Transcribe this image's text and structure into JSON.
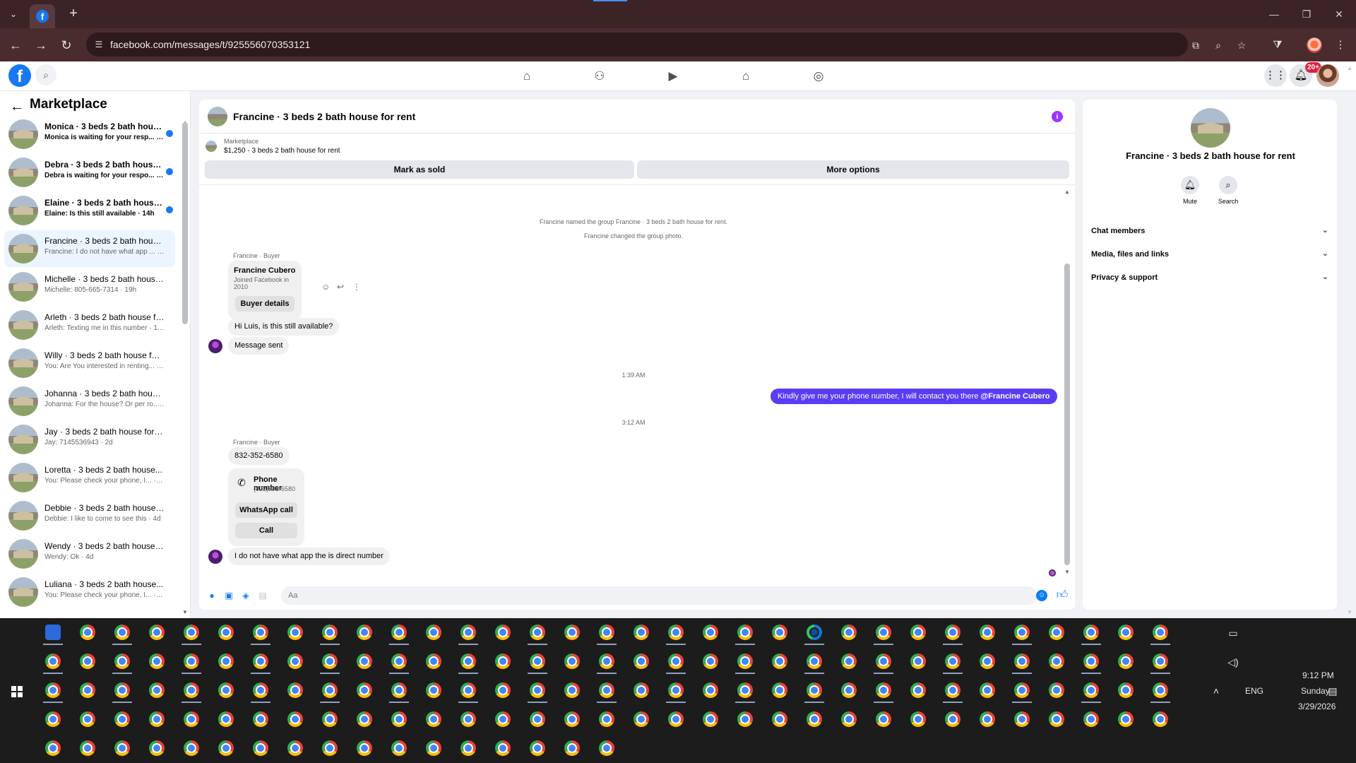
{
  "browser": {
    "url": "facebook.com/messages/t/925556070353121",
    "new_tab": "+",
    "tab_menu": "⌄"
  },
  "sidebar": {
    "title": "Marketplace",
    "conversations": [
      {
        "name": "Monica · 3 beds 2 bath house ...",
        "preview": "Monica is waiting for your resp... · 3h",
        "unread": true
      },
      {
        "name": "Debra · 3 beds 2 bath house f...",
        "preview": "Debra is waiting for your respo... · 3h",
        "unread": true
      },
      {
        "name": "Elaine · 3 beds 2 bath house f...",
        "preview": "Elaine: Is this still available · 14h",
        "unread": true
      },
      {
        "name": "Francine · 3 beds 2 bath house ...",
        "preview": "Francine: I do not have what app ... · 17h",
        "unread": false,
        "active": true
      },
      {
        "name": "Michelle · 3 beds 2 bath house ...",
        "preview": "Michelle: 805-665-7314 · 19h",
        "unread": false
      },
      {
        "name": "Arleth · 3 beds 2 bath house for...",
        "preview": "Arleth: Texting me in this number · 19h",
        "unread": false
      },
      {
        "name": "Willy · 3 beds 2 bath house for ...",
        "preview": "You: Are You interested in renting... · 19h",
        "unread": false
      },
      {
        "name": "Johanna · 3 beds 2 bath house f...",
        "preview": "Johanna: For the house? Or per ro... · 1d",
        "unread": false
      },
      {
        "name": "Jay · 3 beds 2 bath house for rent",
        "preview": "Jay: 7145536943 · 2d",
        "unread": false
      },
      {
        "name": "Loretta · 3 beds 2 bath house...",
        "preview": "You: Please check your phone, I... · 3d",
        "unread": false
      },
      {
        "name": "Debbie · 3 beds 2 bath house f...",
        "preview": "Debbie: I like to come to see this · 4d",
        "unread": false
      },
      {
        "name": "Wendy · 3 beds 2 bath house fo...",
        "preview": "Wendy: Ok · 4d",
        "unread": false
      },
      {
        "name": "Luliana · 3 beds 2 bath house...",
        "preview": "You: Please check your phone, I... · 5d",
        "unread": false
      }
    ]
  },
  "chat": {
    "title": "Francine · 3 beds 2 bath house for rent",
    "marketplace_label": "Marketplace",
    "listing": "$1,250 - 3 beds 2 bath house for rent",
    "mark_sold": "Mark as sold",
    "more_options": "More options",
    "system_1": "Francine named the group Francine · 3 beds 2 bath house for rent.",
    "system_2": "Francine changed the group photo.",
    "sender_1": "Francine · Buyer",
    "card_name": "Francine Cubero",
    "card_joined": "Joined Facebook in 2010",
    "buyer_details": "Buyer details",
    "msg_available": "Hi Luis, is this still available?",
    "msg_sent": "Message sent",
    "time_1": "1:39 AM",
    "out_msg": "Kindly give me your phone number, I will contact you there ",
    "out_mention": "@Francine Cubero",
    "time_2": "3:12 AM",
    "sender_2": "Francine · Buyer",
    "msg_phone": "832-352-6580",
    "phone_title": "Phone number",
    "phone_value": "(832)352-6580",
    "whatsapp": "WhatsApp call",
    "call": "Call",
    "msg_last": "I do not have what app the is direct number",
    "composer_placeholder": "Aa"
  },
  "right_panel": {
    "title": "Francine · 3 beds 2 bath house for rent",
    "mute": "Mute",
    "search": "Search",
    "sections": [
      "Chat members",
      "Media, files and links",
      "Privacy & support"
    ]
  },
  "notifications": {
    "badge": "20+"
  },
  "taskbar": {
    "language": "ENG",
    "time": "9:12 PM",
    "day": "Sunday",
    "date": "3/29/2026"
  },
  "colors": {
    "accent": "#1877f2",
    "outgoing": "#5b3cf6",
    "taskbar": "#1c1c1c"
  }
}
